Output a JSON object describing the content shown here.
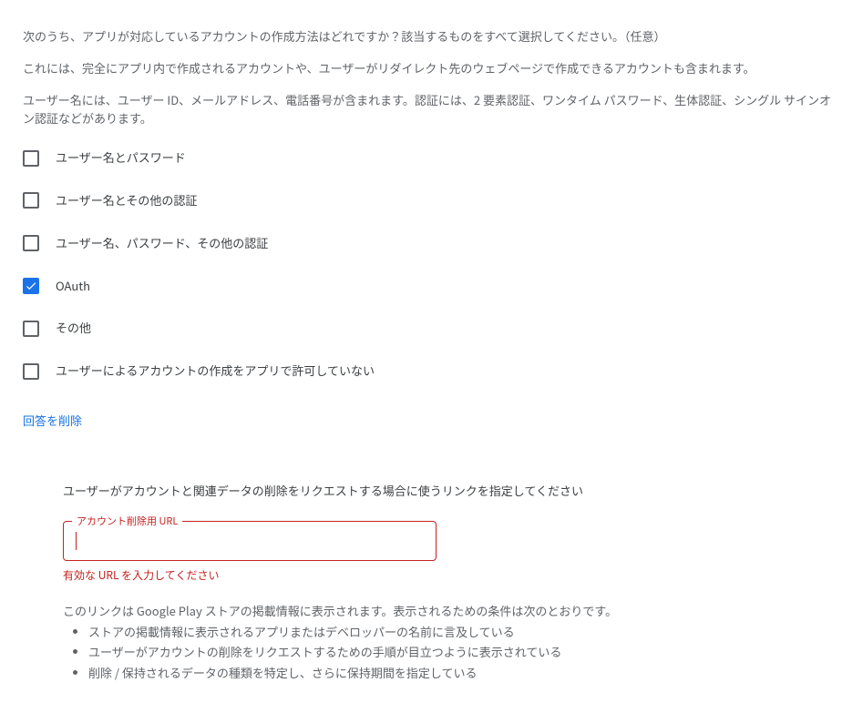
{
  "intro": {
    "q": "次のうち、アプリが対応しているアカウントの作成方法はどれですか？該当するものをすべて選択してください。（任意）",
    "p1": "これには、完全にアプリ内で作成されるアカウントや、ユーザーがリダイレクト先のウェブページで作成できるアカウントも含まれます。",
    "p2": "ユーザー名には、ユーザー ID、メールアドレス、電話番号が含まれます。認証には、2 要素認証、ワンタイム パスワード、生体認証、シングル サインオン認証などがあります。"
  },
  "options": {
    "o0": "ユーザー名とパスワード",
    "o1": "ユーザー名とその他の認証",
    "o2": "ユーザー名、パスワード、その他の認証",
    "o3": "OAuth",
    "o4": "その他",
    "o5": "ユーザーによるアカウントの作成をアプリで許可していない"
  },
  "deleteAnswer": "回答を削除",
  "link": {
    "heading": "ユーザーがアカウントと関連データの削除をリクエストする場合に使うリンクを指定してください",
    "floating": "アカウント削除用 URL",
    "value": "",
    "error": "有効な URL を入力してください",
    "desc": "このリンクは Google Play ストアの掲載情報に表示されます。表示されるための条件は次のとおりです。",
    "c0": "ストアの掲載情報に表示されるアプリまたはデベロッパーの名前に言及している",
    "c1": "ユーザーがアカウントの削除をリクエストするための手順が目立つように表示されている",
    "c2": "削除 / 保持されるデータの種類を特定し、さらに保持期間を指定している"
  }
}
